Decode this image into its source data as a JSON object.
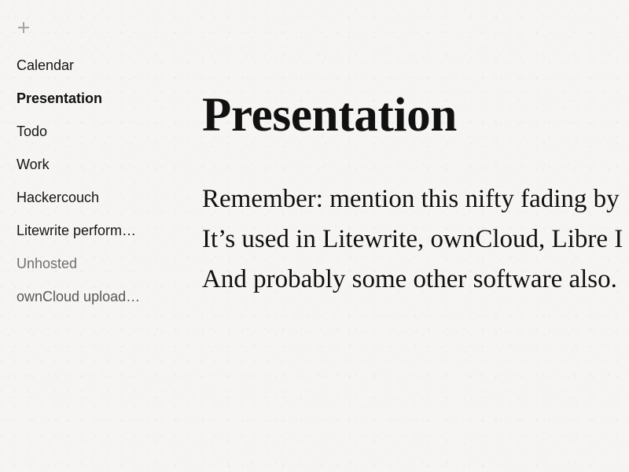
{
  "sidebar": {
    "add_icon": "plus-icon",
    "items": [
      {
        "label": "Calendar",
        "state": "normal"
      },
      {
        "label": "Presentation",
        "state": "active"
      },
      {
        "label": "Todo",
        "state": "normal"
      },
      {
        "label": "Work",
        "state": "normal"
      },
      {
        "label": "Hackercouch",
        "state": "normal"
      },
      {
        "label": "Litewrite perform…",
        "state": "normal"
      },
      {
        "label": "Unhosted",
        "state": "dim"
      },
      {
        "label": "ownCloud upload…",
        "state": "mid"
      }
    ]
  },
  "editor": {
    "title": "Presentation",
    "lines": [
      "Remember: mention this nifty fading by",
      "It’s used in Litewrite, ownCloud, Libre I",
      "And probably some other software also."
    ]
  },
  "colors": {
    "background": "#f6f5f3",
    "text": "#111111",
    "muted": "#6e6e6e",
    "plus": "#a6a6a6"
  }
}
